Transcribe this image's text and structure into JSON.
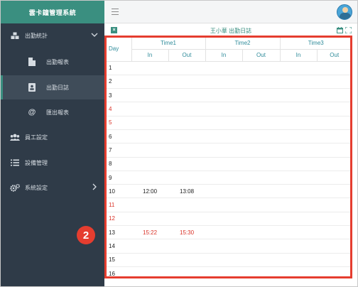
{
  "sidebar": {
    "brand": "雲卡鐘管理系統",
    "items": [
      {
        "label": "出勤統計",
        "icon": "cubes-icon"
      },
      {
        "label": "出勤報表",
        "icon": "file-icon"
      },
      {
        "label": "出勤日誌",
        "icon": "address-card-icon"
      },
      {
        "label": "匯出報表",
        "icon": "at-icon"
      },
      {
        "label": "員工設定",
        "icon": "users-icon"
      },
      {
        "label": "設備管理",
        "icon": "list-icon"
      },
      {
        "label": "系統設定",
        "icon": "cogs-icon"
      }
    ]
  },
  "subheader": {
    "title": "王小華 出勤日誌"
  },
  "table": {
    "day_header": "Day",
    "groups": [
      "Time1",
      "Time2",
      "Time3"
    ],
    "in_label": "In",
    "out_label": "Out",
    "rows": [
      {
        "day": "1"
      },
      {
        "day": "2"
      },
      {
        "day": "3"
      },
      {
        "day": "4"
      },
      {
        "day": "5"
      },
      {
        "day": "6"
      },
      {
        "day": "7"
      },
      {
        "day": "8"
      },
      {
        "day": "9"
      },
      {
        "day": "10",
        "in1": "12:00",
        "out1": "13:08"
      },
      {
        "day": "11"
      },
      {
        "day": "12"
      },
      {
        "day": "13",
        "in1": "15:22",
        "out1": "15:30"
      },
      {
        "day": "14"
      },
      {
        "day": "15"
      },
      {
        "day": "16"
      }
    ]
  },
  "annotation": {
    "badge": "2"
  },
  "colors": {
    "accent": "#3a8f80",
    "sidebar": "#2f3b48",
    "highlight": "#e53d2f",
    "weekend": "#d93025"
  }
}
